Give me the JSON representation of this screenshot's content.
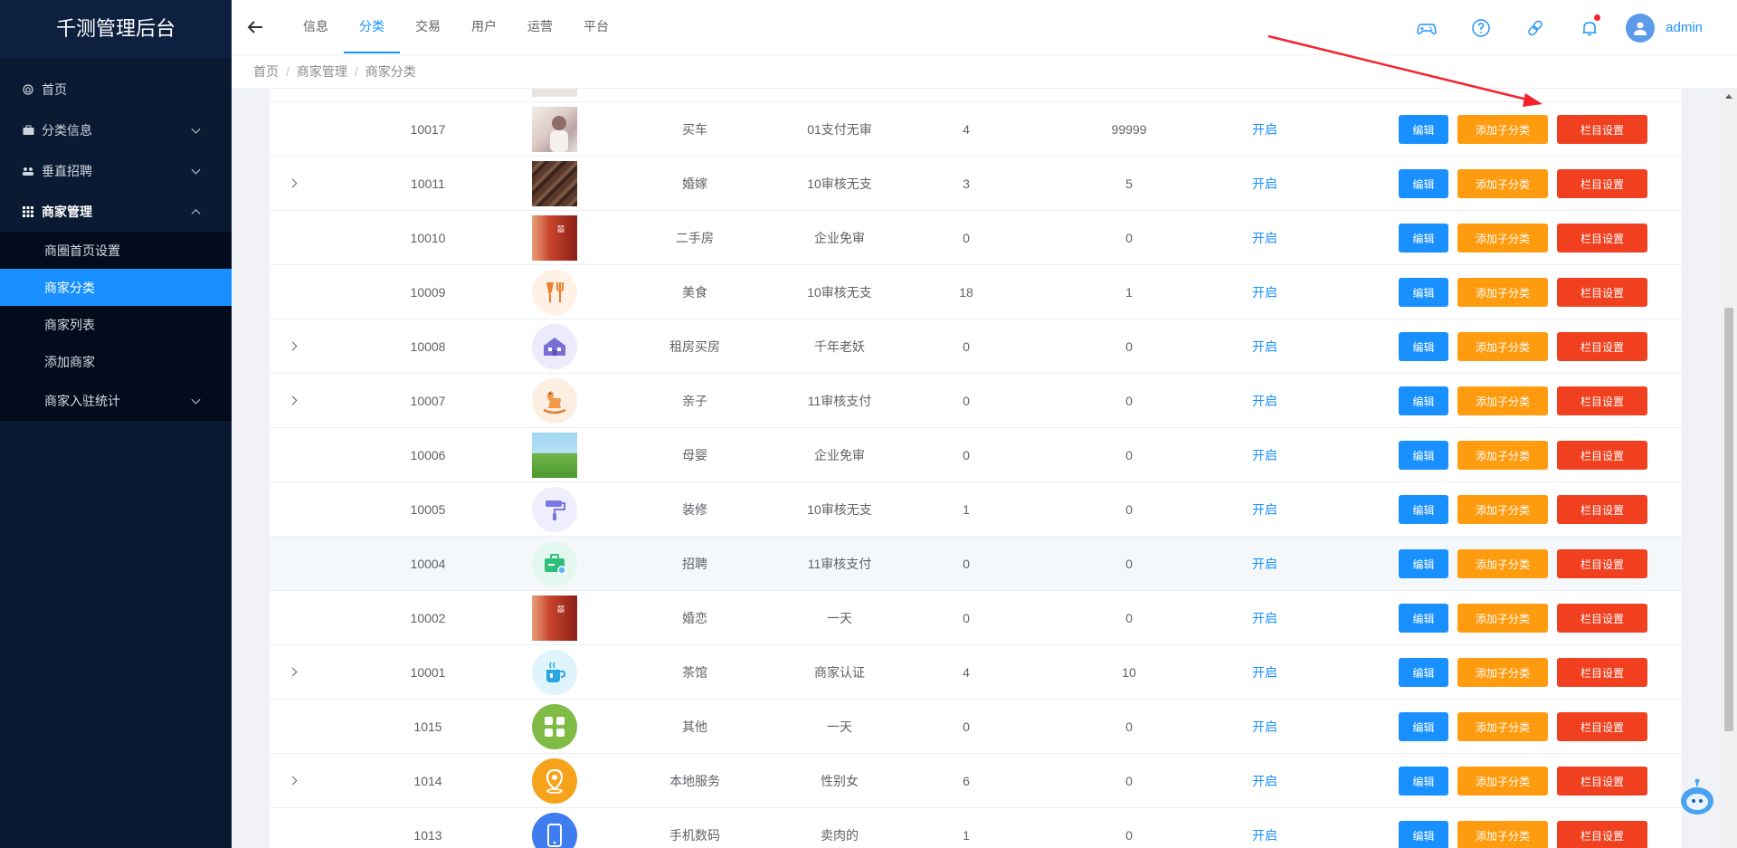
{
  "app": {
    "title": "千测管理后台"
  },
  "sidebar": {
    "items": [
      {
        "label": "首页",
        "icon": "home-icon"
      },
      {
        "label": "分类信息",
        "icon": "briefcase-icon"
      },
      {
        "label": "垂直招聘",
        "icon": "users-icon"
      },
      {
        "label": "商家管理",
        "icon": "grid-icon"
      }
    ],
    "submenu": [
      {
        "label": "商圈首页设置"
      },
      {
        "label": "商家分类"
      },
      {
        "label": "商家列表"
      },
      {
        "label": "添加商家"
      },
      {
        "label": "商家入驻统计"
      }
    ]
  },
  "header": {
    "tabs": [
      "信息",
      "分类",
      "交易",
      "用户",
      "运营",
      "平台"
    ],
    "active_tab": "分类",
    "username": "admin"
  },
  "breadcrumb": [
    "首页",
    "商家管理",
    "商家分类"
  ],
  "table": {
    "status_label": "开启",
    "buttons": {
      "edit": "编辑",
      "add_sub": "添加子分类",
      "column": "栏目设置"
    },
    "rows": [
      {
        "id": "10017",
        "name": "买车",
        "pay": "01支付无审",
        "n1": "4",
        "n2": "99999",
        "expand": false,
        "thumb": "photo-girl"
      },
      {
        "id": "10011",
        "name": "婚嫁",
        "pay": "10审核无支",
        "n1": "3",
        "n2": "5",
        "expand": true,
        "thumb": "photo-brown"
      },
      {
        "id": "10010",
        "name": "二手房",
        "pay": "企业免审",
        "n1": "0",
        "n2": "0",
        "expand": false,
        "thumb": "photo-red"
      },
      {
        "id": "10009",
        "name": "美食",
        "pay": "10审核无支",
        "n1": "18",
        "n2": "1",
        "expand": false,
        "thumb": "food-icon"
      },
      {
        "id": "10008",
        "name": "租房买房",
        "pay": "千年老妖",
        "n1": "0",
        "n2": "0",
        "expand": true,
        "thumb": "house-icon"
      },
      {
        "id": "10007",
        "name": "亲子",
        "pay": "11审核支付",
        "n1": "0",
        "n2": "0",
        "expand": true,
        "thumb": "rocking-horse-icon"
      },
      {
        "id": "10006",
        "name": "母婴",
        "pay": "企业免审",
        "n1": "0",
        "n2": "0",
        "expand": false,
        "thumb": "photo-landscape"
      },
      {
        "id": "10005",
        "name": "装修",
        "pay": "10审核无支",
        "n1": "1",
        "n2": "0",
        "expand": false,
        "thumb": "paint-roller-icon"
      },
      {
        "id": "10004",
        "name": "招聘",
        "pay": "11审核支付",
        "n1": "0",
        "n2": "0",
        "expand": false,
        "thumb": "briefcase-icon"
      },
      {
        "id": "10002",
        "name": "婚恋",
        "pay": "一天",
        "n1": "0",
        "n2": "0",
        "expand": false,
        "thumb": "photo-red"
      },
      {
        "id": "10001",
        "name": "茶馆",
        "pay": "商家认证",
        "n1": "4",
        "n2": "10",
        "expand": true,
        "thumb": "tea-cup-icon"
      },
      {
        "id": "1015",
        "name": "其他",
        "pay": "一天",
        "n1": "0",
        "n2": "0",
        "expand": false,
        "thumb": "apps-icon"
      },
      {
        "id": "1014",
        "name": "本地服务",
        "pay": "性别女",
        "n1": "6",
        "n2": "0",
        "expand": true,
        "thumb": "location-pin-icon"
      },
      {
        "id": "1013",
        "name": "手机数码",
        "pay": "卖肉的",
        "n1": "1",
        "n2": "0",
        "expand": false,
        "thumb": "phone-icon"
      }
    ]
  },
  "colors": {
    "primary": "#1890ff",
    "warning": "#ff9b0f",
    "danger": "#f0401f",
    "sidebar_bg": "#0a1a33"
  }
}
